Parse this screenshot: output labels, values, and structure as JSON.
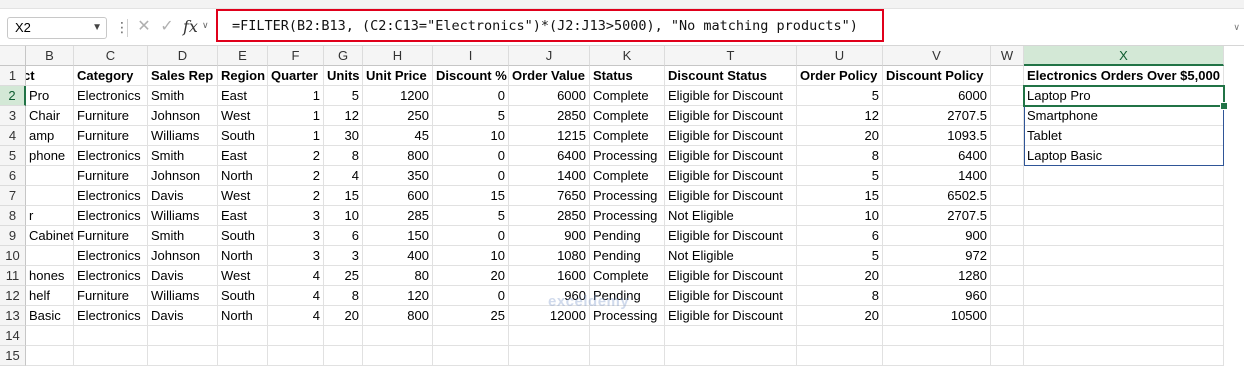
{
  "name_box": "X2",
  "formula": "=FILTER(B2:B13, (C2:C13=\"Electronics\")*(J2:J13>5000), \"No matching products\")",
  "icons": [
    "chevron-down-icon",
    "more-dots-icon",
    "cancel-icon",
    "enter-check-icon",
    "function-icon"
  ],
  "columns": [
    "B",
    "C",
    "D",
    "E",
    "F",
    "G",
    "H",
    "I",
    "J",
    "K",
    "T",
    "U",
    "V",
    "W",
    "X"
  ],
  "rows": [
    "1",
    "2",
    "3",
    "4",
    "5",
    "6",
    "7",
    "8",
    "9",
    "10",
    "11",
    "12",
    "13",
    "14",
    "15"
  ],
  "headers": [
    "ct",
    "Category",
    "Sales Rep",
    "Region",
    "Quarter",
    "Units",
    "Unit Price",
    "Discount %",
    "Order Value",
    "Status",
    "Discount Status",
    "Order Policy",
    "Discount Policy",
    "",
    "Electronics Orders Over $5,000"
  ],
  "data": [
    [
      "Pro",
      "Electronics",
      "Smith",
      "East",
      "1",
      "5",
      "1200",
      "0",
      "6000",
      "Complete",
      "Eligible for Discount",
      "5",
      "6000"
    ],
    [
      "Chair",
      "Furniture",
      "Johnson",
      "West",
      "1",
      "12",
      "250",
      "5",
      "2850",
      "Complete",
      "Eligible for Discount",
      "12",
      "2707.5"
    ],
    [
      "amp",
      "Furniture",
      "Williams",
      "South",
      "1",
      "30",
      "45",
      "10",
      "1215",
      "Complete",
      "Eligible for Discount",
      "20",
      "1093.5"
    ],
    [
      "phone",
      "Electronics",
      "Smith",
      "East",
      "2",
      "8",
      "800",
      "0",
      "6400",
      "Processing",
      "Eligible for Discount",
      "8",
      "6400"
    ],
    [
      "",
      "Furniture",
      "Johnson",
      "North",
      "2",
      "4",
      "350",
      "0",
      "1400",
      "Complete",
      "Eligible for Discount",
      "5",
      "1400"
    ],
    [
      "",
      "Electronics",
      "Davis",
      "West",
      "2",
      "15",
      "600",
      "15",
      "7650",
      "Processing",
      "Eligible for Discount",
      "15",
      "6502.5"
    ],
    [
      "r",
      "Electronics",
      "Williams",
      "East",
      "3",
      "10",
      "285",
      "5",
      "2850",
      "Processing",
      "Not Eligible",
      "10",
      "2707.5"
    ],
    [
      "Cabinet",
      "Furniture",
      "Smith",
      "South",
      "3",
      "6",
      "150",
      "0",
      "900",
      "Pending",
      "Eligible for Discount",
      "6",
      "900"
    ],
    [
      "",
      "Electronics",
      "Johnson",
      "North",
      "3",
      "3",
      "400",
      "10",
      "1080",
      "Pending",
      "Not Eligible",
      "5",
      "972"
    ],
    [
      "hones",
      "Electronics",
      "Davis",
      "West",
      "4",
      "25",
      "80",
      "20",
      "1600",
      "Complete",
      "Eligible for Discount",
      "20",
      "1280"
    ],
    [
      "helf",
      "Furniture",
      "Williams",
      "South",
      "4",
      "8",
      "120",
      "0",
      "960",
      "Pending",
      "Eligible for Discount",
      "8",
      "960"
    ],
    [
      "Basic",
      "Electronics",
      "Davis",
      "North",
      "4",
      "20",
      "800",
      "25",
      "12000",
      "Processing",
      "Eligible for Discount",
      "20",
      "10500"
    ]
  ],
  "filter_results": [
    "Laptop Pro",
    "Smartphone",
    "Tablet",
    "Laptop Basic"
  ],
  "watermark": "exceldemy",
  "colors": {
    "accent": "#217346",
    "highlight_red": "#e0001b",
    "result_border": "#2f5597"
  }
}
